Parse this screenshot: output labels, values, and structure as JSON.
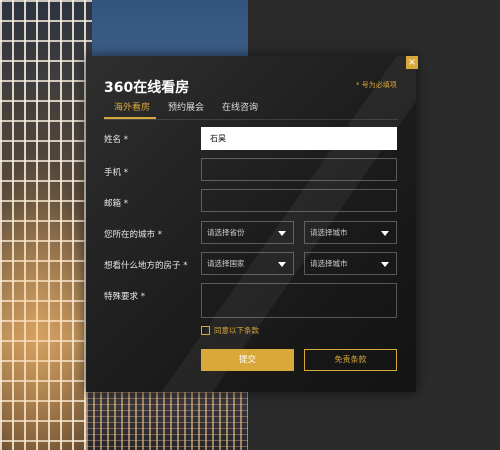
{
  "modal": {
    "title": "360在线看房",
    "required_note": "* 号为必填项",
    "close_symbol": "×"
  },
  "tabs": [
    {
      "label": "海外看房",
      "active": true
    },
    {
      "label": "预约展会",
      "active": false
    },
    {
      "label": "在线咨询",
      "active": false
    }
  ],
  "form": {
    "name_label": "姓名 *",
    "name_value": "石昊",
    "phone_label": "手机 *",
    "phone_value": "",
    "email_label": "邮箱 *",
    "email_value": "",
    "city_label": "您所在的城市 *",
    "province_select": "请选择省份",
    "city_select": "请选择城市",
    "house_label": "想看什么地方的房子 *",
    "country_select": "请选择国家",
    "house_city_select": "请选择城市",
    "notes_label": "特殊要求 *",
    "notes_value": "",
    "agree_text": "同意以下条款",
    "submit_label": "提交",
    "terms_label": "免责条款"
  },
  "colors": {
    "accent": "#d9a83a",
    "modal_bg": "#1c1c1c"
  }
}
